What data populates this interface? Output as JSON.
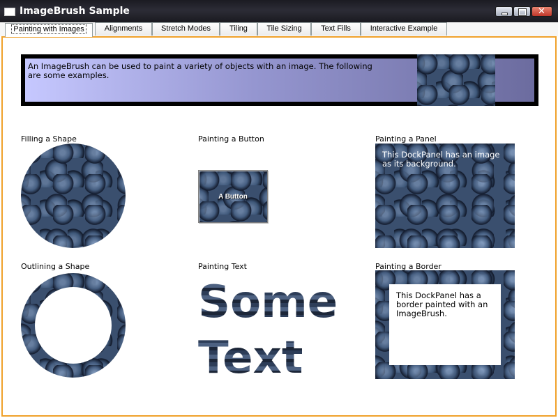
{
  "window": {
    "title": "ImageBrush Sample"
  },
  "tabs": [
    {
      "label": "Painting with Images"
    },
    {
      "label": "Alignments"
    },
    {
      "label": "Stretch Modes"
    },
    {
      "label": "Tiling"
    },
    {
      "label": "Tile Sizing"
    },
    {
      "label": "Text Fills"
    },
    {
      "label": "Interactive Example"
    }
  ],
  "selected_tab": "Painting with Images",
  "banner": {
    "text": "An ImageBrush can be used to paint a variety of objects with an image. The following are some examples."
  },
  "sections": {
    "filling_shape": {
      "label": "Filling a Shape"
    },
    "painting_button": {
      "label": "Painting a Button",
      "button_text": "A Button"
    },
    "painting_panel": {
      "label": "Painting a Panel",
      "panel_text": "This DockPanel has an image as its background."
    },
    "outlining_shape": {
      "label": "Outlining a Shape"
    },
    "painting_text": {
      "label": "Painting Text",
      "text": "Some Text"
    },
    "painting_border": {
      "label": "Painting a Border",
      "panel_text": "This DockPanel has a border painted with an ImageBrush."
    }
  },
  "colors": {
    "frame_accent": "#f0a12a",
    "titlebar": "#22222a",
    "banner_gradient_start": "#c6c8ff",
    "banner_gradient_end": "#6c6c9f"
  }
}
